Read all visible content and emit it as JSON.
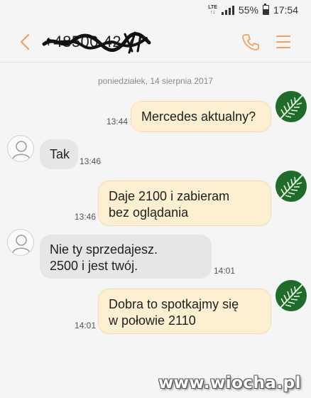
{
  "status_bar": {
    "network": "LTE",
    "battery": "55%",
    "time": "17:54"
  },
  "header": {
    "contact_name": "+48500 42 7",
    "icons": {
      "back": "chevron-left-icon",
      "call": "phone-icon",
      "menu": "hamburger-menu-icon"
    },
    "accent_color": "#f0a060"
  },
  "date_separator": "poniedziałek, 14 sierpnia 2017",
  "messages": [
    {
      "direction": "out",
      "text": "Mercedes aktualny?",
      "time": "13:44"
    },
    {
      "direction": "in",
      "text": "Tak",
      "time": "13:46"
    },
    {
      "direction": "out",
      "line1": "Daje 2100 i zabieram",
      "line2": "bez oglądania",
      "time": "13:46"
    },
    {
      "direction": "in",
      "line1": "Nie ty sprzedajesz.",
      "line2": "2500 i jest twój.",
      "time": "14:01"
    },
    {
      "direction": "out",
      "line1": "Dobra to spotkajmy się",
      "line2": "w połowie 2110",
      "time": "14:01"
    }
  ],
  "colors": {
    "outgoing_bubble": "#fcefd2",
    "incoming_bubble": "#e6e6e6",
    "background": "#f5f5f5"
  },
  "watermark": "www.wiocha.pl"
}
